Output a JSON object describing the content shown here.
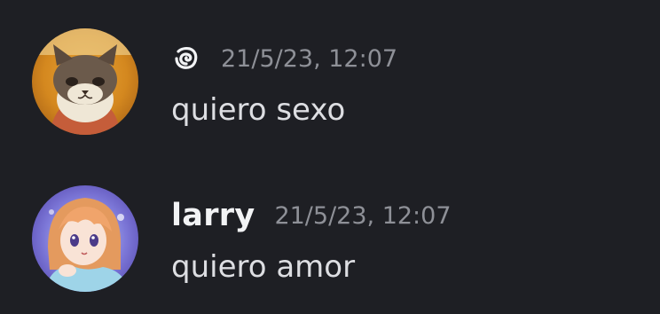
{
  "messages": [
    {
      "author": "",
      "author_glyph": "spiral-icon",
      "timestamp": "21/5/23, 12:07",
      "text": "quiero sexo",
      "avatar": "cat-plush-avatar"
    },
    {
      "author": "larry",
      "timestamp": "21/5/23, 12:07",
      "text": "quiero amor",
      "avatar": "anime-girl-avatar"
    }
  ],
  "colors": {
    "background": "#1e1f24",
    "username": "#f2f3f5",
    "timestamp": "#8e9097",
    "message_text": "#dddee2"
  }
}
